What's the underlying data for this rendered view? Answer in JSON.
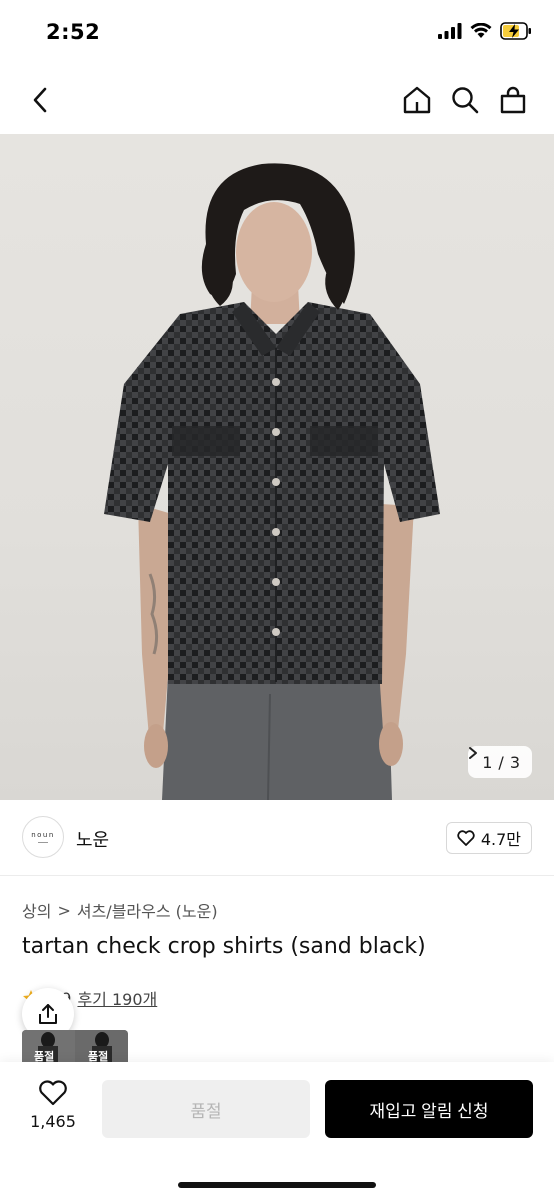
{
  "status_bar": {
    "time": "2:52"
  },
  "nav": {
    "back_icon": "chevron-left-icon",
    "home_icon": "home-icon",
    "search_icon": "search-icon",
    "cart_icon": "shopping-bag-icon"
  },
  "gallery": {
    "current": "1",
    "separator": "/",
    "total": "3"
  },
  "brand": {
    "logo_text": "noun",
    "name": "노운",
    "likes": "4.7만"
  },
  "breadcrumb": {
    "category": "상의",
    "separator": ">",
    "subcategory": "셔츠/블라우스 (노운)"
  },
  "product": {
    "title": "tartan check crop shirts (sand black)",
    "rating": "4.9",
    "review_link": "후기 190개"
  },
  "thumbnails": {
    "labels": [
      "품절",
      "품절"
    ]
  },
  "bottom": {
    "wish_count": "1,465",
    "soldout_label": "품절",
    "restock_label": "재입고 알림 신청"
  },
  "colors": {
    "accent": "#000000",
    "disabled_bg": "#efefef",
    "disabled_text": "#b5b5b5"
  }
}
